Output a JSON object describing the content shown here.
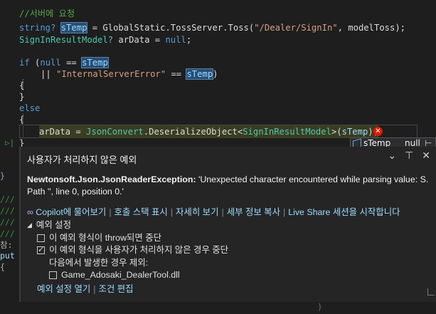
{
  "code": {
    "comment": "//서버에 요청",
    "line1": {
      "kw": "string?",
      "var": "sTemp",
      "rest1": " = GlobalStatic.TossServer.Toss(",
      "str": "\"/Dealer/SignIn\"",
      "rest2": ", modelToss);"
    },
    "line2": {
      "ty": "SignInResultModel?",
      "rest": " arData = ",
      "kw": "null",
      ";": ";"
    },
    "line3": {
      "kw": "if",
      "p1": " (",
      "kw2": "null",
      "op": " == ",
      "var": "sTemp"
    },
    "line4": {
      "op": "|| ",
      "str": "\"InternalServerError\"",
      "op2": " == ",
      "var": "sTemp",
      "close": ")"
    },
    "open_brace": "{",
    "close_brace": "}",
    "else_kw": "else",
    "line_assign": {
      "a": "arData = ",
      "ty": "JsonConvert",
      "b": ".DeserializeObject<",
      "ty2": "SignInResultModel",
      "c": ">(",
      "var": "sTemp",
      "d": ");"
    },
    "gutter_sep": "!=",
    "left_slashes": [
      "///",
      "///",
      "///",
      "///"
    ],
    "left_labels": [
      "참:",
      "put",
      "{"
    ],
    "bottom_fragment": "                                                          ) "
  },
  "datatip": {
    "name": "sTemp",
    "value": "null"
  },
  "popup": {
    "title": "사용자가 처리하지 않은 예외",
    "exception_type": "Newtonsoft.Json.JsonReaderException:",
    "message": " 'Unexpected character encountered while parsing value: S. Path '', line 0, position 0.'",
    "links": [
      "Copilot에 물어보기",
      "호출 스택 표시",
      "자세히 보기",
      "세부 정보 복사",
      "Live Share 세션을 시작합니다"
    ],
    "settings_header": "예외 설정",
    "opt1": "이 예외 형식이 throw되면 중단",
    "opt2": "이 예외 형식을 사용자가 처리하지 않은 경우 중단",
    "except_from": "다음에서 발생한 경우 제외:",
    "dll": "Game_Adosaki_DealerTool.dll",
    "footer_links": [
      "예외 설정 열기",
      "조건 편집"
    ]
  }
}
